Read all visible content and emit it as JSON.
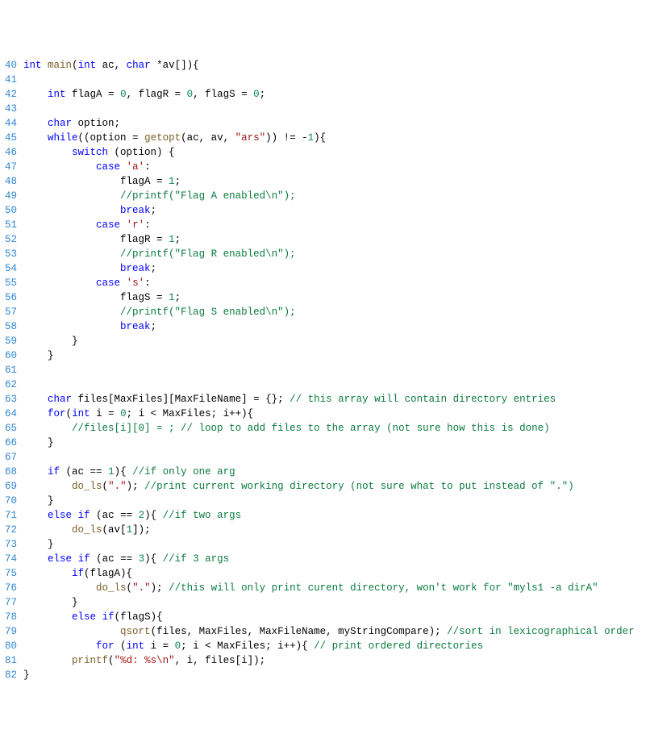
{
  "lineStart": 40,
  "lineEnd": 82,
  "code": {
    "l40": [
      [
        "kw",
        "int"
      ],
      [
        "op",
        " "
      ],
      [
        "fn",
        "main"
      ],
      [
        "op",
        "("
      ],
      [
        "kw",
        "int"
      ],
      [
        "op",
        " ac, "
      ],
      [
        "kw",
        "char"
      ],
      [
        "op",
        " *av[]){"
      ]
    ],
    "l41": [],
    "l42": [
      [
        "op",
        "    "
      ],
      [
        "kw",
        "int"
      ],
      [
        "op",
        " flagA = "
      ],
      [
        "num",
        "0"
      ],
      [
        "op",
        ", flagR = "
      ],
      [
        "num",
        "0"
      ],
      [
        "op",
        ", flagS = "
      ],
      [
        "num",
        "0"
      ],
      [
        "op",
        ";"
      ]
    ],
    "l43": [],
    "l44": [
      [
        "op",
        "    "
      ],
      [
        "kw",
        "char"
      ],
      [
        "op",
        " option;"
      ]
    ],
    "l45": [
      [
        "op",
        "    "
      ],
      [
        "kw",
        "while"
      ],
      [
        "op",
        "((option = "
      ],
      [
        "fn",
        "getopt"
      ],
      [
        "op",
        "(ac, av, "
      ],
      [
        "str",
        "\"ars\""
      ],
      [
        "op",
        ")) != -"
      ],
      [
        "num",
        "1"
      ],
      [
        "op",
        "){"
      ]
    ],
    "l46": [
      [
        "op",
        "        "
      ],
      [
        "kw",
        "switch"
      ],
      [
        "op",
        " (option) {"
      ]
    ],
    "l47": [
      [
        "op",
        "            "
      ],
      [
        "kw",
        "case"
      ],
      [
        "op",
        " "
      ],
      [
        "str",
        "'a'"
      ],
      [
        "op",
        ":"
      ]
    ],
    "l48": [
      [
        "op",
        "                flagA = "
      ],
      [
        "num",
        "1"
      ],
      [
        "op",
        ";"
      ]
    ],
    "l49": [
      [
        "op",
        "                "
      ],
      [
        "cmt",
        "//printf(\"Flag A enabled\\n\");"
      ]
    ],
    "l50": [
      [
        "op",
        "                "
      ],
      [
        "kw",
        "break"
      ],
      [
        "op",
        ";"
      ]
    ],
    "l51": [
      [
        "op",
        "            "
      ],
      [
        "kw",
        "case"
      ],
      [
        "op",
        " "
      ],
      [
        "str",
        "'r'"
      ],
      [
        "op",
        ":"
      ]
    ],
    "l52": [
      [
        "op",
        "                flagR = "
      ],
      [
        "num",
        "1"
      ],
      [
        "op",
        ";"
      ]
    ],
    "l53": [
      [
        "op",
        "                "
      ],
      [
        "cmt",
        "//printf(\"Flag R enabled\\n\");"
      ]
    ],
    "l54": [
      [
        "op",
        "                "
      ],
      [
        "kw",
        "break"
      ],
      [
        "op",
        ";"
      ]
    ],
    "l55": [
      [
        "op",
        "            "
      ],
      [
        "kw",
        "case"
      ],
      [
        "op",
        " "
      ],
      [
        "str",
        "'s'"
      ],
      [
        "op",
        ":"
      ]
    ],
    "l56": [
      [
        "op",
        "                flagS = "
      ],
      [
        "num",
        "1"
      ],
      [
        "op",
        ";"
      ]
    ],
    "l57": [
      [
        "op",
        "                "
      ],
      [
        "cmt",
        "//printf(\"Flag S enabled\\n\");"
      ]
    ],
    "l58": [
      [
        "op",
        "                "
      ],
      [
        "kw",
        "break"
      ],
      [
        "op",
        ";"
      ]
    ],
    "l59": [
      [
        "op",
        "        }"
      ]
    ],
    "l60": [
      [
        "op",
        "    }"
      ]
    ],
    "l61": [],
    "l62": [],
    "l63": [
      [
        "op",
        "    "
      ],
      [
        "kw",
        "char"
      ],
      [
        "op",
        " files[MaxFiles][MaxFileName] = {}; "
      ],
      [
        "cmt",
        "// this array will contain directory entries"
      ]
    ],
    "l64": [
      [
        "op",
        "    "
      ],
      [
        "kw",
        "for"
      ],
      [
        "op",
        "("
      ],
      [
        "kw",
        "int"
      ],
      [
        "op",
        " i = "
      ],
      [
        "num",
        "0"
      ],
      [
        "op",
        "; i < MaxFiles; i++){"
      ]
    ],
    "l65": [
      [
        "op",
        "        "
      ],
      [
        "cmt",
        "//files[i][0] = ; // loop to add files to the array (not sure how this is done)"
      ]
    ],
    "l66": [
      [
        "op",
        "    }"
      ]
    ],
    "l67": [],
    "l68": [
      [
        "op",
        "    "
      ],
      [
        "kw",
        "if"
      ],
      [
        "op",
        " (ac == "
      ],
      [
        "num",
        "1"
      ],
      [
        "op",
        "){ "
      ],
      [
        "cmt",
        "//if only one arg"
      ]
    ],
    "l69": [
      [
        "op",
        "        "
      ],
      [
        "fn",
        "do_ls"
      ],
      [
        "op",
        "("
      ],
      [
        "str",
        "\".\""
      ],
      [
        "op",
        "); "
      ],
      [
        "cmt",
        "//print current working directory (not sure what to put instead of \".\")"
      ]
    ],
    "l70": [
      [
        "op",
        "    }"
      ]
    ],
    "l71": [
      [
        "op",
        "    "
      ],
      [
        "kw",
        "else"
      ],
      [
        "op",
        " "
      ],
      [
        "kw",
        "if"
      ],
      [
        "op",
        " (ac == "
      ],
      [
        "num",
        "2"
      ],
      [
        "op",
        "){ "
      ],
      [
        "cmt",
        "//if two args"
      ]
    ],
    "l72": [
      [
        "op",
        "        "
      ],
      [
        "fn",
        "do_ls"
      ],
      [
        "op",
        "(av["
      ],
      [
        "num",
        "1"
      ],
      [
        "op",
        "]);"
      ]
    ],
    "l73": [
      [
        "op",
        "    }"
      ]
    ],
    "l74": [
      [
        "op",
        "    "
      ],
      [
        "kw",
        "else"
      ],
      [
        "op",
        " "
      ],
      [
        "kw",
        "if"
      ],
      [
        "op",
        " (ac == "
      ],
      [
        "num",
        "3"
      ],
      [
        "op",
        "){ "
      ],
      [
        "cmt",
        "//if 3 args"
      ]
    ],
    "l75": [
      [
        "op",
        "        "
      ],
      [
        "kw",
        "if"
      ],
      [
        "op",
        "(flagA){"
      ]
    ],
    "l76": [
      [
        "op",
        "            "
      ],
      [
        "fn",
        "do_ls"
      ],
      [
        "op",
        "("
      ],
      [
        "str",
        "\".\""
      ],
      [
        "op",
        "); "
      ],
      [
        "cmt",
        "//this will only print curent directory, won't work for \"myls1 -a dirA\""
      ]
    ],
    "l77": [
      [
        "op",
        "        }"
      ]
    ],
    "l78": [
      [
        "op",
        "        "
      ],
      [
        "kw",
        "else"
      ],
      [
        "op",
        " "
      ],
      [
        "kw",
        "if"
      ],
      [
        "op",
        "(flagS){"
      ]
    ],
    "l79": [
      [
        "op",
        "                "
      ],
      [
        "fn",
        "qsort"
      ],
      [
        "op",
        "(files, MaxFiles, MaxFileName, myStringCompare); "
      ],
      [
        "cmt",
        "//sort in lexicographical order"
      ]
    ],
    "l80": [
      [
        "op",
        "            "
      ],
      [
        "kw",
        "for"
      ],
      [
        "op",
        " ("
      ],
      [
        "kw",
        "int"
      ],
      [
        "op",
        " i = "
      ],
      [
        "num",
        "0"
      ],
      [
        "op",
        "; i < MaxFiles; i++){ "
      ],
      [
        "cmt",
        "// print ordered directories"
      ]
    ],
    "l81": [
      [
        "op",
        "        "
      ],
      [
        "fn",
        "printf"
      ],
      [
        "op",
        "("
      ],
      [
        "str",
        "\"%d: %s\\n\""
      ],
      [
        "op",
        ", i, files[i]);"
      ]
    ],
    "l82": [
      [
        "op",
        "}"
      ]
    ]
  }
}
